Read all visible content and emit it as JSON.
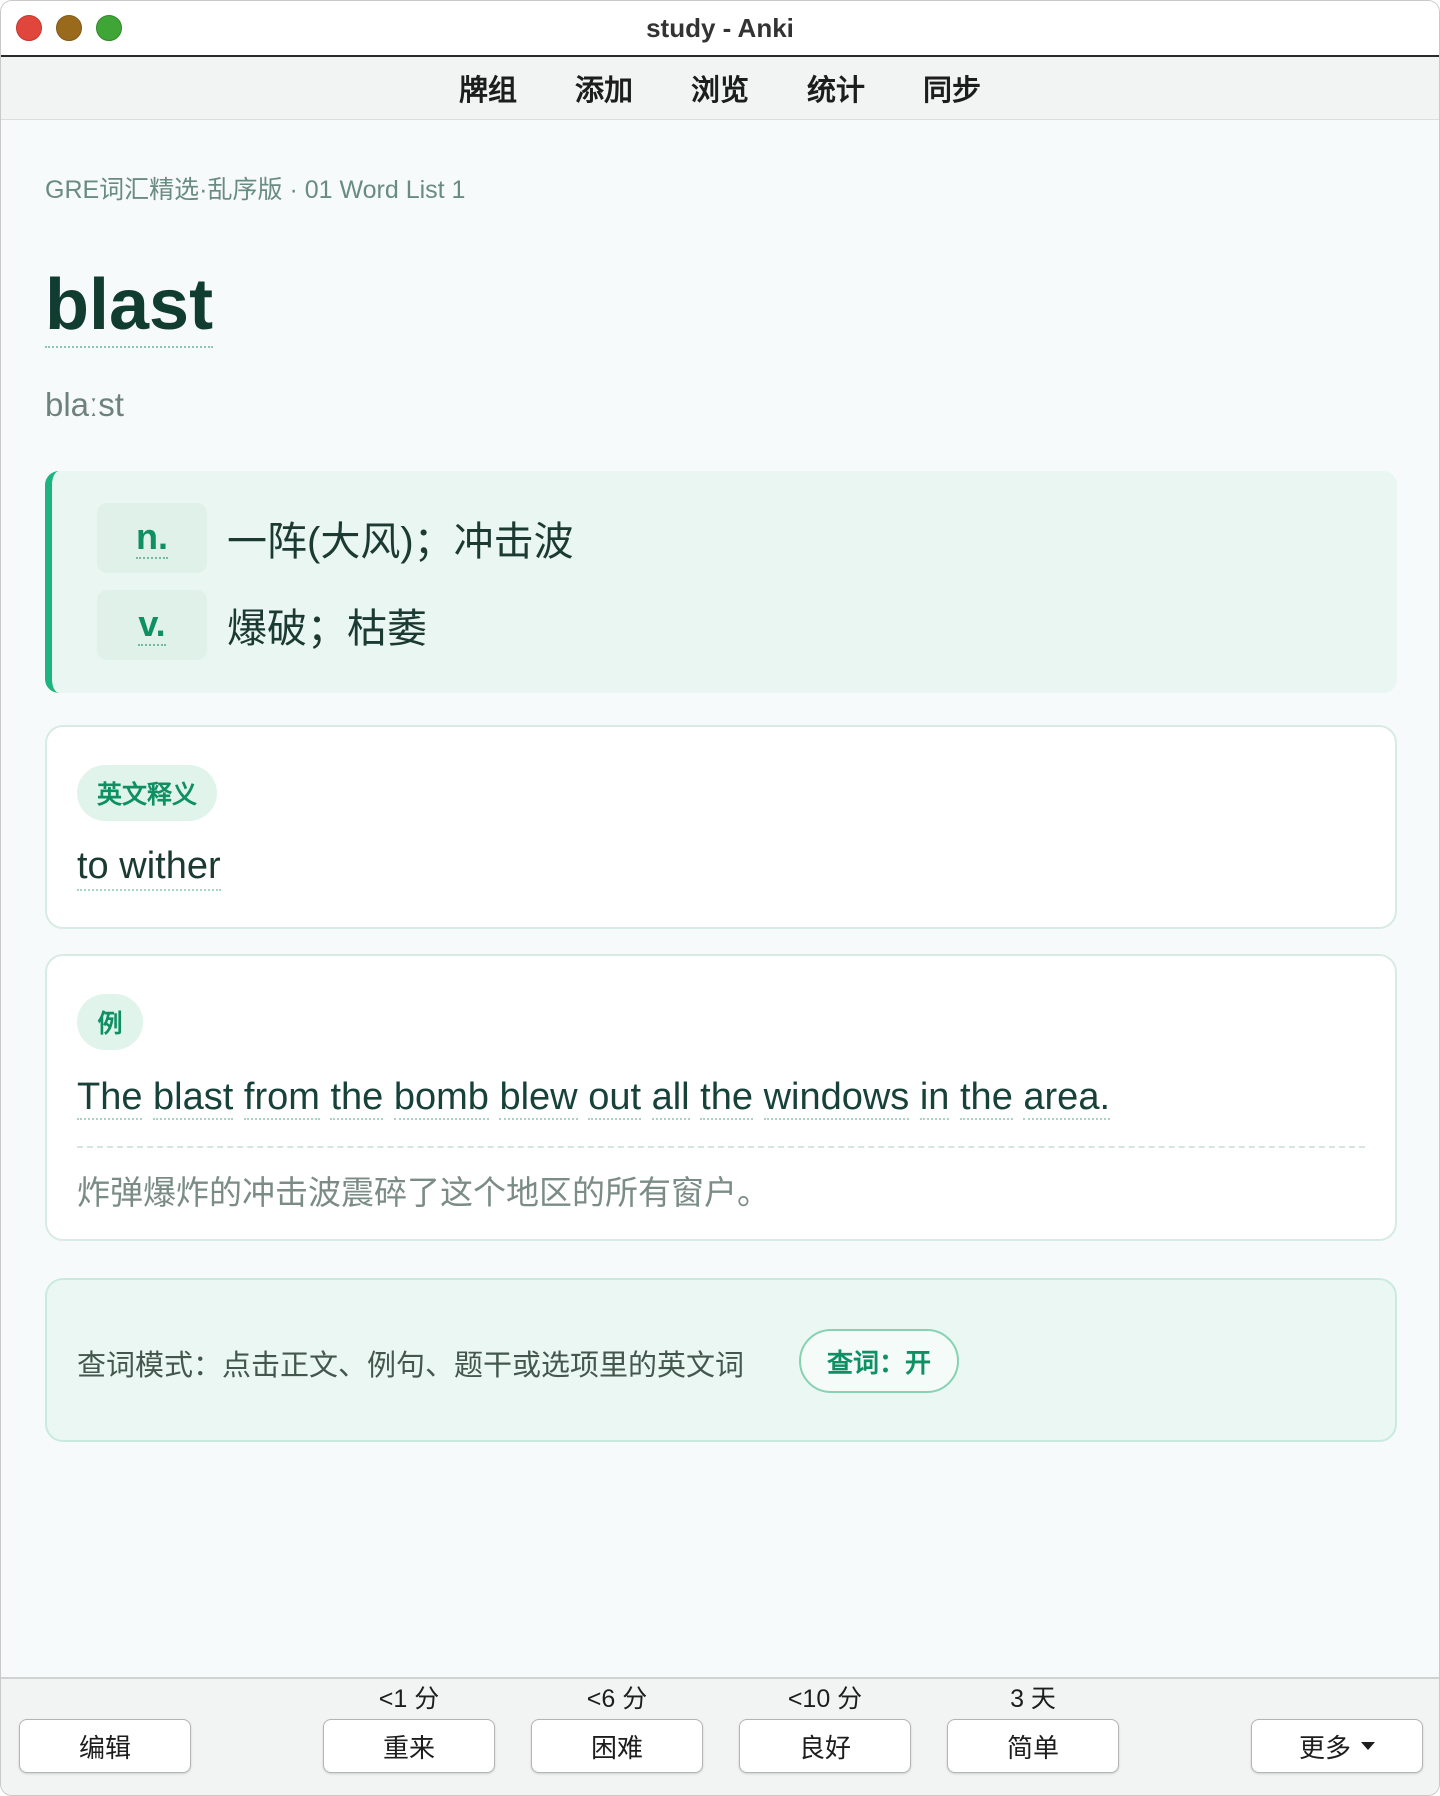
{
  "window": {
    "title": "study - Anki"
  },
  "toolbar": {
    "items": [
      "牌组",
      "添加",
      "浏览",
      "统计",
      "同步"
    ]
  },
  "card": {
    "deck_path": "GRE词汇精选·乱序版 · 01 Word List 1",
    "word": "blast",
    "phonetic": "blaːst",
    "definitions": [
      {
        "pos": "n.",
        "meaning": "一阵(大风)；冲击波"
      },
      {
        "pos": "v.",
        "meaning": "爆破；枯萎"
      }
    ],
    "english_definition": {
      "badge": "英文释义",
      "text": "to wither"
    },
    "example": {
      "badge": "例",
      "sentence_words": [
        "The",
        "blast",
        "from",
        "the",
        "bomb",
        "blew",
        "out",
        "all",
        "the",
        "windows",
        "in",
        "the",
        "area."
      ],
      "translation": "炸弹爆炸的冲击波震碎了这个地区的所有窗户。"
    },
    "lookup": {
      "text": "查词模式：点击正文、例句、题干或选项里的英文词",
      "toggle_label": "查词：开"
    }
  },
  "answer_bar": {
    "edit_label": "编辑",
    "more_label": "更多",
    "again": {
      "label": "重来",
      "interval": "<1 分"
    },
    "hard": {
      "label": "困难",
      "interval": "<6 分"
    },
    "good": {
      "label": "良好",
      "interval": "<10 分"
    },
    "easy": {
      "label": "简单",
      "interval": "3 天"
    }
  },
  "colors": {
    "accent": "#1db57f",
    "accent_text": "#0e8f64",
    "word": "#113d31"
  }
}
